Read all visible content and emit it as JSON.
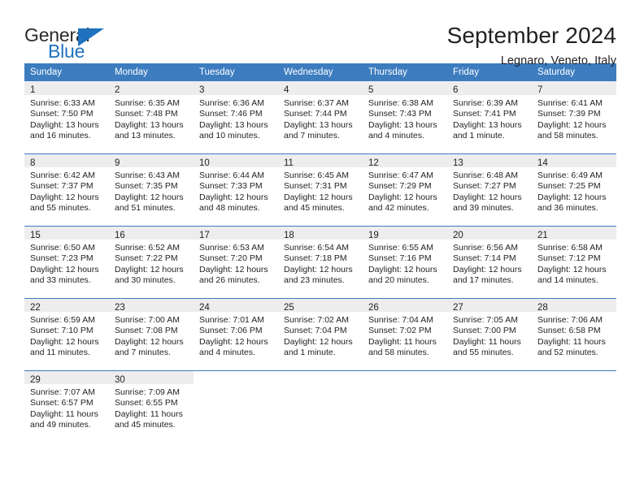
{
  "logo": {
    "word_top": "General",
    "word_bottom": "Blue",
    "triangle_color": "#1f72bd",
    "text_color": "#2b2b2b"
  },
  "header": {
    "month_title": "September 2024",
    "location": "Legnaro, Veneto, Italy"
  },
  "theme": {
    "header_blue": "#3c7cbf",
    "daynum_bg": "#ededed",
    "text": "#231f20"
  },
  "weekday_headers": [
    "Sunday",
    "Monday",
    "Tuesday",
    "Wednesday",
    "Thursday",
    "Friday",
    "Saturday"
  ],
  "weeks": [
    [
      {
        "day": "1",
        "sunrise": "Sunrise: 6:33 AM",
        "sunset": "Sunset: 7:50 PM",
        "daylight_1": "Daylight: 13 hours",
        "daylight_2": "and 16 minutes."
      },
      {
        "day": "2",
        "sunrise": "Sunrise: 6:35 AM",
        "sunset": "Sunset: 7:48 PM",
        "daylight_1": "Daylight: 13 hours",
        "daylight_2": "and 13 minutes."
      },
      {
        "day": "3",
        "sunrise": "Sunrise: 6:36 AM",
        "sunset": "Sunset: 7:46 PM",
        "daylight_1": "Daylight: 13 hours",
        "daylight_2": "and 10 minutes."
      },
      {
        "day": "4",
        "sunrise": "Sunrise: 6:37 AM",
        "sunset": "Sunset: 7:44 PM",
        "daylight_1": "Daylight: 13 hours",
        "daylight_2": "and 7 minutes."
      },
      {
        "day": "5",
        "sunrise": "Sunrise: 6:38 AM",
        "sunset": "Sunset: 7:43 PM",
        "daylight_1": "Daylight: 13 hours",
        "daylight_2": "and 4 minutes."
      },
      {
        "day": "6",
        "sunrise": "Sunrise: 6:39 AM",
        "sunset": "Sunset: 7:41 PM",
        "daylight_1": "Daylight: 13 hours",
        "daylight_2": "and 1 minute."
      },
      {
        "day": "7",
        "sunrise": "Sunrise: 6:41 AM",
        "sunset": "Sunset: 7:39 PM",
        "daylight_1": "Daylight: 12 hours",
        "daylight_2": "and 58 minutes."
      }
    ],
    [
      {
        "day": "8",
        "sunrise": "Sunrise: 6:42 AM",
        "sunset": "Sunset: 7:37 PM",
        "daylight_1": "Daylight: 12 hours",
        "daylight_2": "and 55 minutes."
      },
      {
        "day": "9",
        "sunrise": "Sunrise: 6:43 AM",
        "sunset": "Sunset: 7:35 PM",
        "daylight_1": "Daylight: 12 hours",
        "daylight_2": "and 51 minutes."
      },
      {
        "day": "10",
        "sunrise": "Sunrise: 6:44 AM",
        "sunset": "Sunset: 7:33 PM",
        "daylight_1": "Daylight: 12 hours",
        "daylight_2": "and 48 minutes."
      },
      {
        "day": "11",
        "sunrise": "Sunrise: 6:45 AM",
        "sunset": "Sunset: 7:31 PM",
        "daylight_1": "Daylight: 12 hours",
        "daylight_2": "and 45 minutes."
      },
      {
        "day": "12",
        "sunrise": "Sunrise: 6:47 AM",
        "sunset": "Sunset: 7:29 PM",
        "daylight_1": "Daylight: 12 hours",
        "daylight_2": "and 42 minutes."
      },
      {
        "day": "13",
        "sunrise": "Sunrise: 6:48 AM",
        "sunset": "Sunset: 7:27 PM",
        "daylight_1": "Daylight: 12 hours",
        "daylight_2": "and 39 minutes."
      },
      {
        "day": "14",
        "sunrise": "Sunrise: 6:49 AM",
        "sunset": "Sunset: 7:25 PM",
        "daylight_1": "Daylight: 12 hours",
        "daylight_2": "and 36 minutes."
      }
    ],
    [
      {
        "day": "15",
        "sunrise": "Sunrise: 6:50 AM",
        "sunset": "Sunset: 7:23 PM",
        "daylight_1": "Daylight: 12 hours",
        "daylight_2": "and 33 minutes."
      },
      {
        "day": "16",
        "sunrise": "Sunrise: 6:52 AM",
        "sunset": "Sunset: 7:22 PM",
        "daylight_1": "Daylight: 12 hours",
        "daylight_2": "and 30 minutes."
      },
      {
        "day": "17",
        "sunrise": "Sunrise: 6:53 AM",
        "sunset": "Sunset: 7:20 PM",
        "daylight_1": "Daylight: 12 hours",
        "daylight_2": "and 26 minutes."
      },
      {
        "day": "18",
        "sunrise": "Sunrise: 6:54 AM",
        "sunset": "Sunset: 7:18 PM",
        "daylight_1": "Daylight: 12 hours",
        "daylight_2": "and 23 minutes."
      },
      {
        "day": "19",
        "sunrise": "Sunrise: 6:55 AM",
        "sunset": "Sunset: 7:16 PM",
        "daylight_1": "Daylight: 12 hours",
        "daylight_2": "and 20 minutes."
      },
      {
        "day": "20",
        "sunrise": "Sunrise: 6:56 AM",
        "sunset": "Sunset: 7:14 PM",
        "daylight_1": "Daylight: 12 hours",
        "daylight_2": "and 17 minutes."
      },
      {
        "day": "21",
        "sunrise": "Sunrise: 6:58 AM",
        "sunset": "Sunset: 7:12 PM",
        "daylight_1": "Daylight: 12 hours",
        "daylight_2": "and 14 minutes."
      }
    ],
    [
      {
        "day": "22",
        "sunrise": "Sunrise: 6:59 AM",
        "sunset": "Sunset: 7:10 PM",
        "daylight_1": "Daylight: 12 hours",
        "daylight_2": "and 11 minutes."
      },
      {
        "day": "23",
        "sunrise": "Sunrise: 7:00 AM",
        "sunset": "Sunset: 7:08 PM",
        "daylight_1": "Daylight: 12 hours",
        "daylight_2": "and 7 minutes."
      },
      {
        "day": "24",
        "sunrise": "Sunrise: 7:01 AM",
        "sunset": "Sunset: 7:06 PM",
        "daylight_1": "Daylight: 12 hours",
        "daylight_2": "and 4 minutes."
      },
      {
        "day": "25",
        "sunrise": "Sunrise: 7:02 AM",
        "sunset": "Sunset: 7:04 PM",
        "daylight_1": "Daylight: 12 hours",
        "daylight_2": "and 1 minute."
      },
      {
        "day": "26",
        "sunrise": "Sunrise: 7:04 AM",
        "sunset": "Sunset: 7:02 PM",
        "daylight_1": "Daylight: 11 hours",
        "daylight_2": "and 58 minutes."
      },
      {
        "day": "27",
        "sunrise": "Sunrise: 7:05 AM",
        "sunset": "Sunset: 7:00 PM",
        "daylight_1": "Daylight: 11 hours",
        "daylight_2": "and 55 minutes."
      },
      {
        "day": "28",
        "sunrise": "Sunrise: 7:06 AM",
        "sunset": "Sunset: 6:58 PM",
        "daylight_1": "Daylight: 11 hours",
        "daylight_2": "and 52 minutes."
      }
    ],
    [
      {
        "day": "29",
        "sunrise": "Sunrise: 7:07 AM",
        "sunset": "Sunset: 6:57 PM",
        "daylight_1": "Daylight: 11 hours",
        "daylight_2": "and 49 minutes."
      },
      {
        "day": "30",
        "sunrise": "Sunrise: 7:09 AM",
        "sunset": "Sunset: 6:55 PM",
        "daylight_1": "Daylight: 11 hours",
        "daylight_2": "and 45 minutes."
      },
      {
        "day": "",
        "sunrise": "",
        "sunset": "",
        "daylight_1": "",
        "daylight_2": ""
      },
      {
        "day": "",
        "sunrise": "",
        "sunset": "",
        "daylight_1": "",
        "daylight_2": ""
      },
      {
        "day": "",
        "sunrise": "",
        "sunset": "",
        "daylight_1": "",
        "daylight_2": ""
      },
      {
        "day": "",
        "sunrise": "",
        "sunset": "",
        "daylight_1": "",
        "daylight_2": ""
      },
      {
        "day": "",
        "sunrise": "",
        "sunset": "",
        "daylight_1": "",
        "daylight_2": ""
      }
    ]
  ]
}
